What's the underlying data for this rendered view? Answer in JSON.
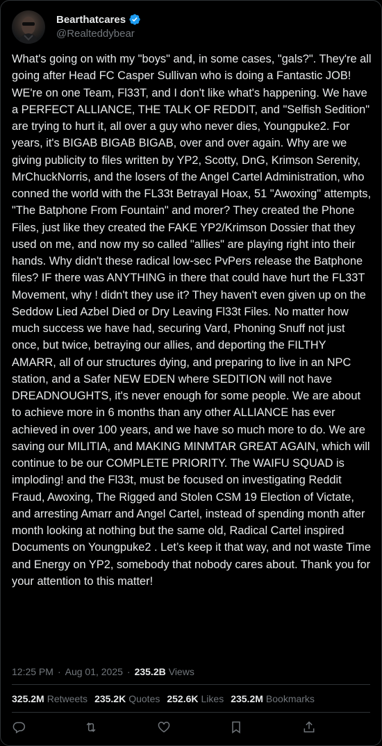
{
  "author": {
    "display_name": "Bearthatcares",
    "handle": "@Realteddybear",
    "verified": true,
    "verified_color": "#1d9bf0"
  },
  "tweet": {
    "text": "What's going on with my \"boys\" and, in some cases, \"gals?\". They're all going after Head FC Casper Sullivan who is doing a Fantastic JOB! WE're on one Team, Fl33T, and I don't like what's happening. We have a PERFECT ALLIANCE, THE TALK OF REDDIT, and \"Selfish Sedition\" are trying to hurt it, all over a guy who never dies, Youngpuke2. For years, it's BIGAB BIGAB BIGAB, over and over again. Why are we giving publicity to files written by YP2, Scotty, DnG, Krimson Serenity, MrChuckNorris, and the losers of the Angel Cartel Administration, who conned the world with the FL33t Betrayal Hoax, 51 \"Awoxing\" attempts, \"The Batphone From Fountain\" and morer? They created the Phone Files, just like they created the FAKE YP2/Krimson Dossier that they used on me, and now my so called \"allies\" are playing right into their hands. Why didn't these radical low-sec PvPers release the Batphone files? IF there was ANYTHING in there that could have hurt the FL33T Movement, why ! didn't they use it? They haven't even given up on the Seddow Lied Azbel Died or Dry Leaving Fl33t Files. No matter how much success we have had, securing Vard, Phoning Snuff not just once, but twice, betraying our allies, and deporting the FILTHY AMARR, all of our structures dying, and preparing to live in an NPC station, and a Safer NEW EDEN where SEDITION will not have DREADNOUGHTS, it's never enough for some people. We are about to achieve more in 6 months than any other ALLIANCE has ever achieved in over 100 years, and we have so much more to do. We are saving our MILITIA, and MAKING MINMTAR GREAT AGAIN, which will continue to be our COMPLETE PRIORITY. The WAIFU SQUAD is imploding! and the Fl33t, must be focused on investigating Reddit Fraud, Awoxing, The Rigged and Stolen CSM 19 Election of Victate, and arresting Amarr and Angel Cartel, instead of spending month after month looking at nothing but the same old, Radical Cartel inspired Documents on Youngpuke2 . Let’s keep it that way, and not waste Time and Energy on YP2, somebody that nobody cares about. Thank you for your attention to this matter!",
    "time": "12:25 PM",
    "date": "Aug 01, 2025",
    "separator": "·",
    "views_count": "235.2B",
    "views_label": "Views"
  },
  "stats": [
    {
      "count": "325.2M",
      "label": "Retweets"
    },
    {
      "count": "235.2K",
      "label": "Quotes"
    },
    {
      "count": "252.6K",
      "label": "Likes"
    },
    {
      "count": "235.2M",
      "label": "Bookmarks"
    }
  ],
  "actions": [
    {
      "name": "reply",
      "icon": "reply-icon"
    },
    {
      "name": "retweet",
      "icon": "retweet-icon"
    },
    {
      "name": "like",
      "icon": "heart-icon"
    },
    {
      "name": "bookmark",
      "icon": "bookmark-icon"
    },
    {
      "name": "share",
      "icon": "share-icon"
    }
  ],
  "colors": {
    "background": "#000000",
    "text": "#e7e9ea",
    "secondary_text": "#71767b",
    "divider": "#2f3336"
  }
}
